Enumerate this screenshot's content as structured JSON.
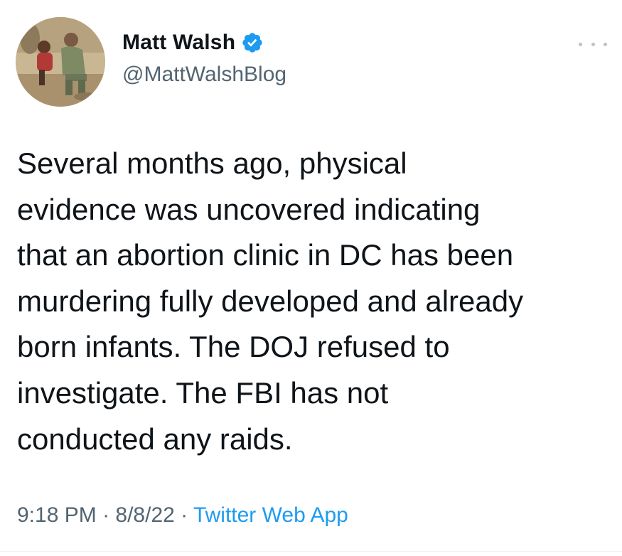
{
  "author": {
    "display_name": "Matt Walsh",
    "handle": "@MattWalshBlog",
    "verified": true,
    "avatar_icon": "profile-photo"
  },
  "more_icon": "more-dots-icon",
  "tweet": {
    "lines": [
      "Several months ago, physical",
      "evidence was uncovered indicating",
      "that an abortion clinic in DC has been",
      "murdering fully developed and already",
      "born infants. The DOJ refused to",
      "investigate. The FBI has not",
      "conducted any raids."
    ]
  },
  "meta": {
    "time": "9:18 PM",
    "date": "8/8/22",
    "separator": " · ",
    "source": "Twitter Web App"
  },
  "colors": {
    "text": "#0f1419",
    "secondary": "#536471",
    "link": "#1d9bf0",
    "verified_badge": "#1d9bf0"
  }
}
